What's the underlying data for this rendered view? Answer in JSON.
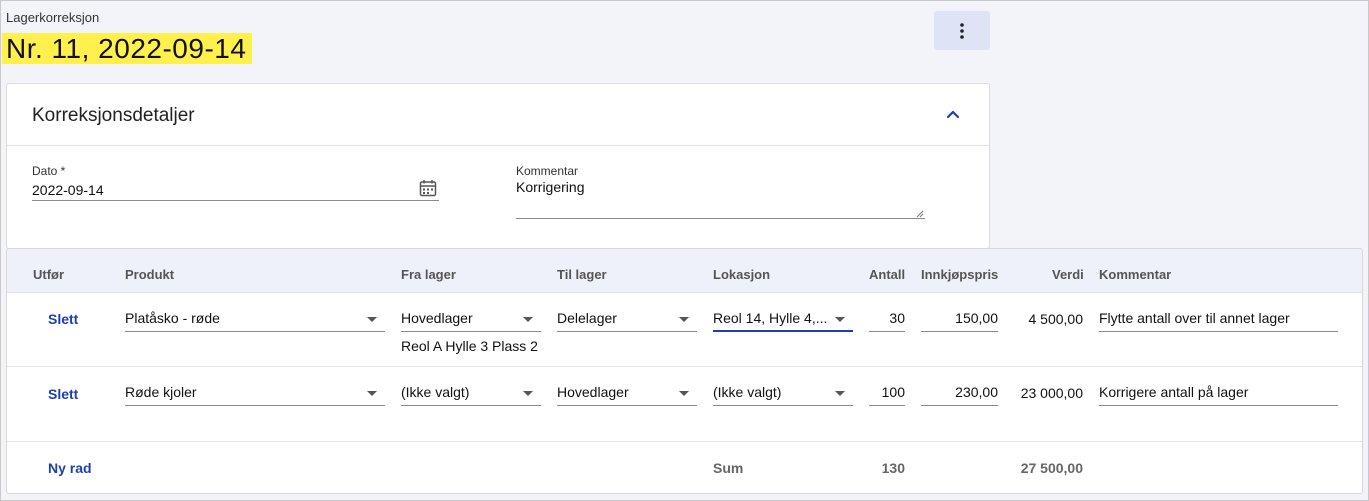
{
  "page": {
    "subtitle": "Lagerkorreksjon",
    "title": "Nr. 11, 2022-09-14",
    "more_icon": "more-vertical-icon"
  },
  "details": {
    "heading": "Korreksjonsdetaljer",
    "date_label": "Dato *",
    "date_value": "2022-09-14",
    "comment_label": "Kommentar",
    "comment_value": "Korrigering"
  },
  "table": {
    "columns": [
      "Utfør",
      "Produkt",
      "Fra lager",
      "Til lager",
      "Lokasjon",
      "Antall",
      "Innkjøpspris",
      "Verdi",
      "Kommentar"
    ],
    "rows": [
      {
        "action": "Slett",
        "product": "Platåsko - røde",
        "from_warehouse": "Hovedlager",
        "from_location": "Reol A Hylle 3 Plass 2",
        "to_warehouse": "Delelager",
        "location": "Reol 14, Hylle 4,...",
        "quantity": "30",
        "price": "150,00",
        "value": "4 500,00",
        "comment": "Flytte antall over til annet lager"
      },
      {
        "action": "Slett",
        "product": "Røde kjoler",
        "from_warehouse": "(Ikke valgt)",
        "from_location": "",
        "to_warehouse": "Hovedlager",
        "location": "(Ikke valgt)",
        "quantity": "100",
        "price": "230,00",
        "value": "23 000,00",
        "comment": "Korrigere antall på lager"
      }
    ],
    "new_row": "Ny rad",
    "sum_label": "Sum",
    "sum_quantity": "130",
    "sum_value": "27 500,00"
  },
  "colors": {
    "accent": "#1d3fb3",
    "highlight": "#fff04d",
    "background": "#f3f4fa",
    "header_bg": "#eef1fa"
  }
}
